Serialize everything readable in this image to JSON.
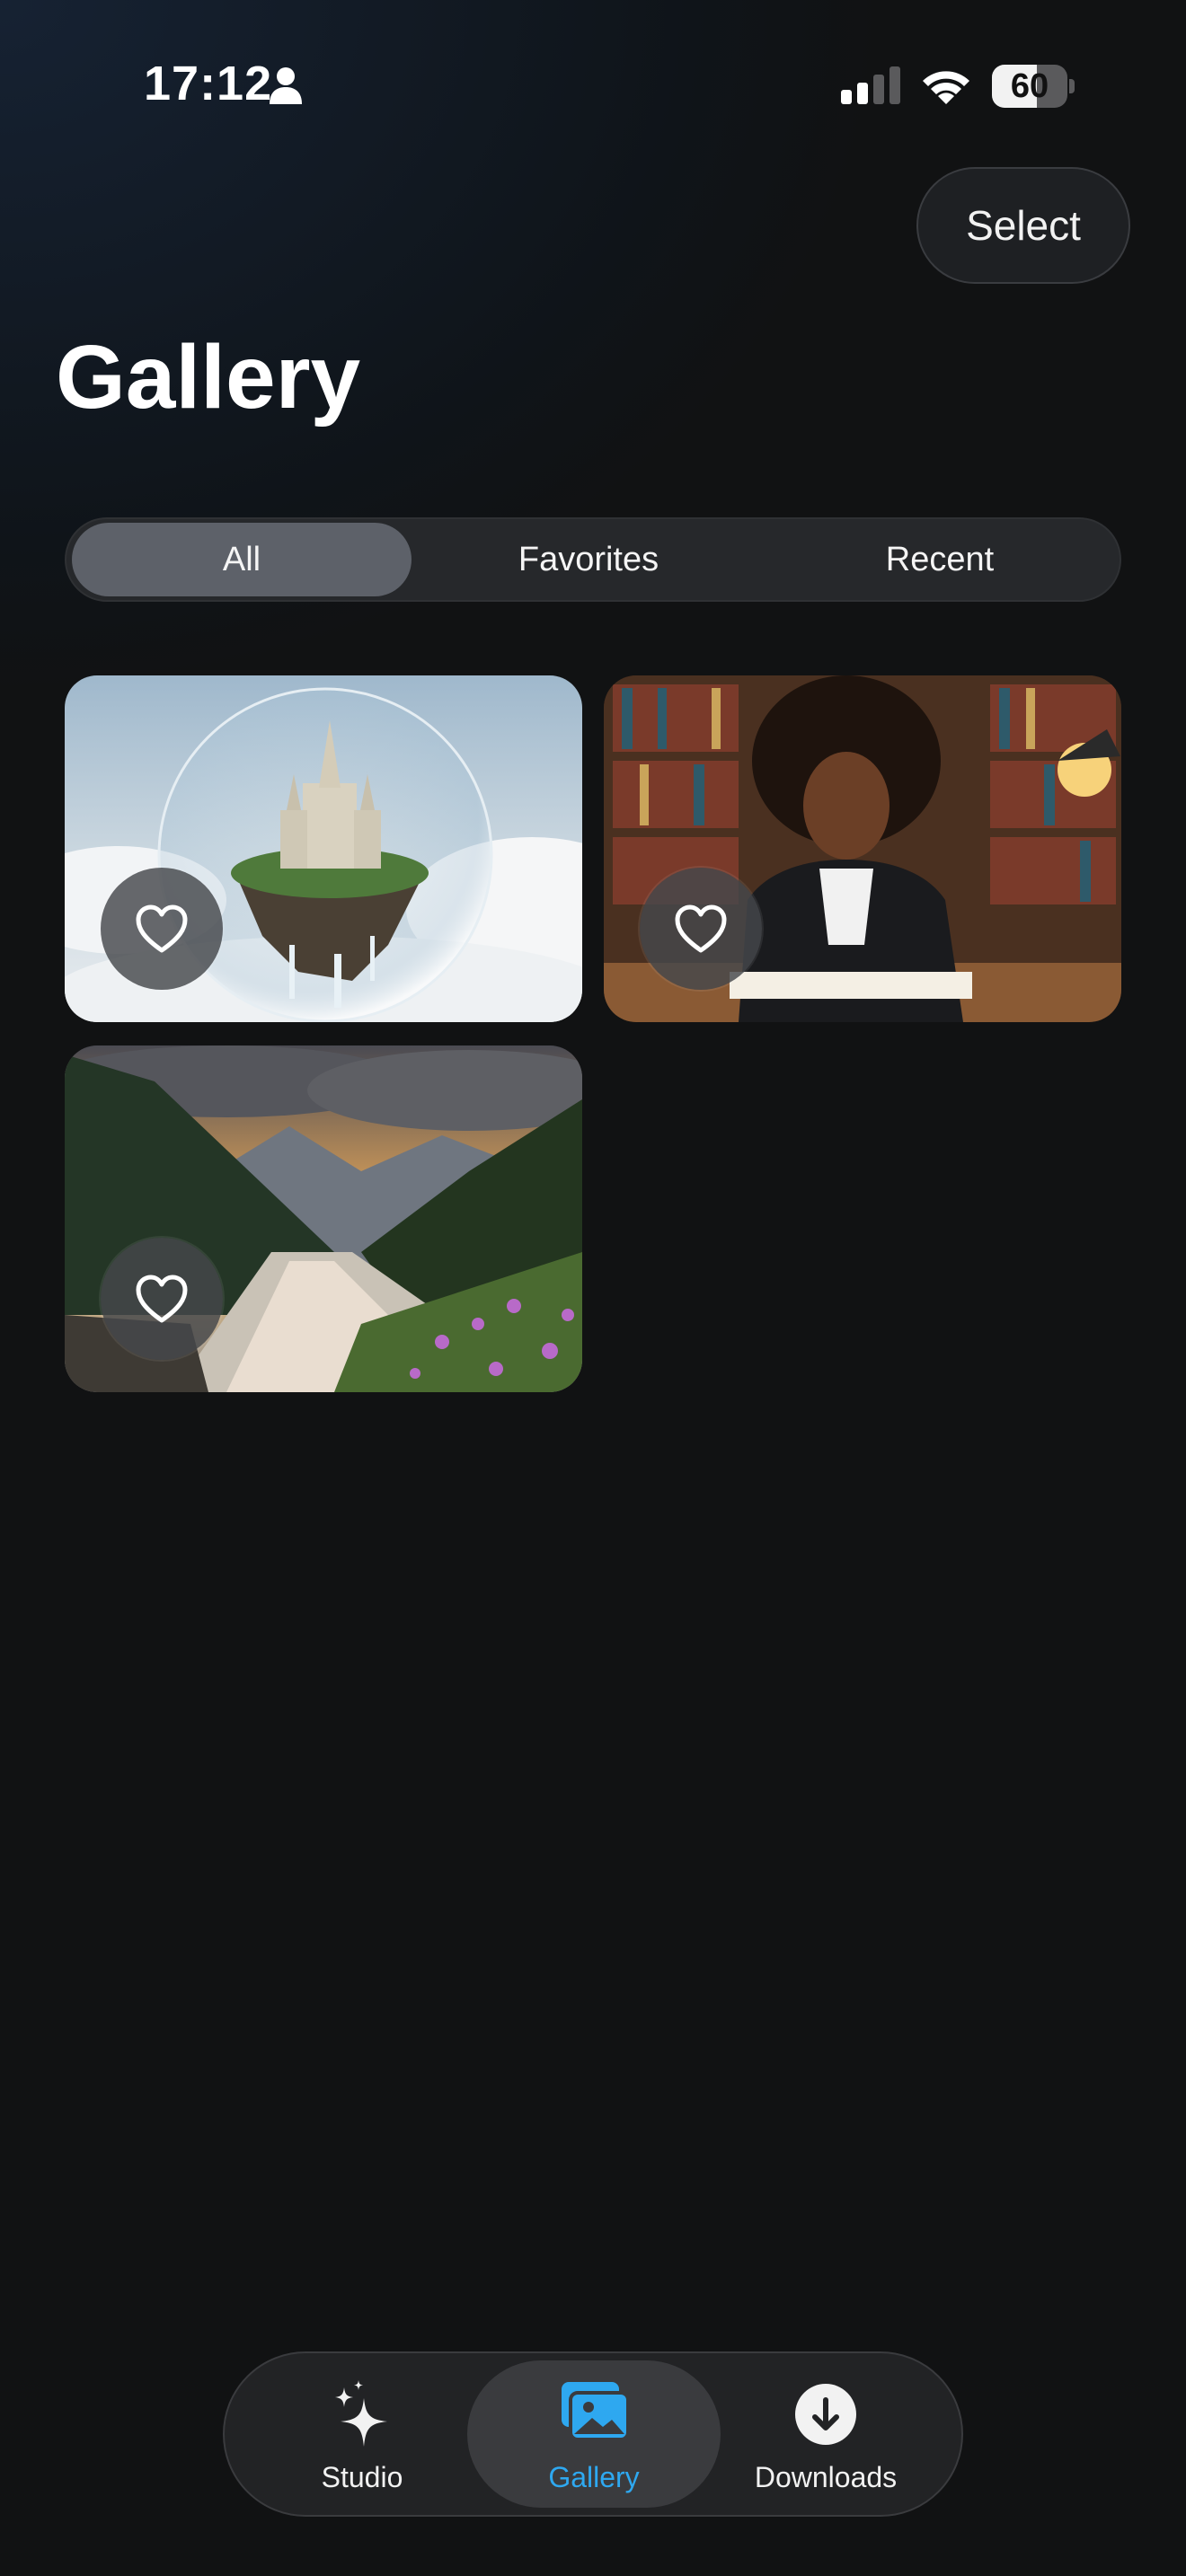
{
  "status_bar": {
    "time": "17:12",
    "battery": "60",
    "battery_level": 0.6
  },
  "header": {
    "select_label": "Select",
    "title": "Gallery"
  },
  "filter_tabs": [
    {
      "label": "All",
      "selected": true
    },
    {
      "label": "Favorites",
      "selected": false
    },
    {
      "label": "Recent",
      "selected": false
    }
  ],
  "gallery_items": [
    {
      "subject": "floating castle in a bubble above clouds",
      "favorite": false
    },
    {
      "subject": "woman writing at a desk in a library",
      "favorite": false
    },
    {
      "subject": "mountain river valley at sunset with purple flowers",
      "favorite": false
    }
  ],
  "tab_bar": {
    "items": [
      {
        "label": "Studio",
        "icon": "sparkles-icon",
        "active": false
      },
      {
        "label": "Gallery",
        "icon": "photos-icon",
        "active": true
      },
      {
        "label": "Downloads",
        "icon": "download-circle-icon",
        "active": false
      }
    ],
    "accent_color": "#2ea8f0"
  }
}
